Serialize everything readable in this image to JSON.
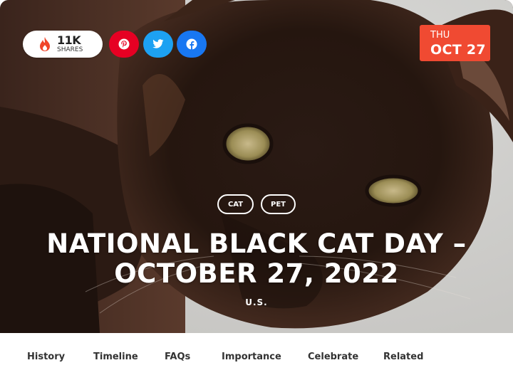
{
  "share": {
    "count": "11K",
    "label": "SHARES",
    "icon": "flame-icon"
  },
  "social": [
    {
      "name": "pinterest",
      "icon": "pinterest-icon",
      "color": "#e60023"
    },
    {
      "name": "twitter",
      "icon": "twitter-icon",
      "color": "#1da1f2"
    },
    {
      "name": "facebook",
      "icon": "facebook-icon",
      "color": "#1877f2"
    }
  ],
  "date": {
    "day_of_week": "THU",
    "month_day": "OCT 27",
    "color": "#f04a32"
  },
  "tags": [
    "CAT",
    "PET"
  ],
  "title": "NATIONAL BLACK CAT DAY – OCTOBER 27, 2022",
  "region": "U.S.",
  "nav": [
    "History",
    "Timeline",
    "FAQs",
    "Importance",
    "Celebrate",
    "Related"
  ]
}
